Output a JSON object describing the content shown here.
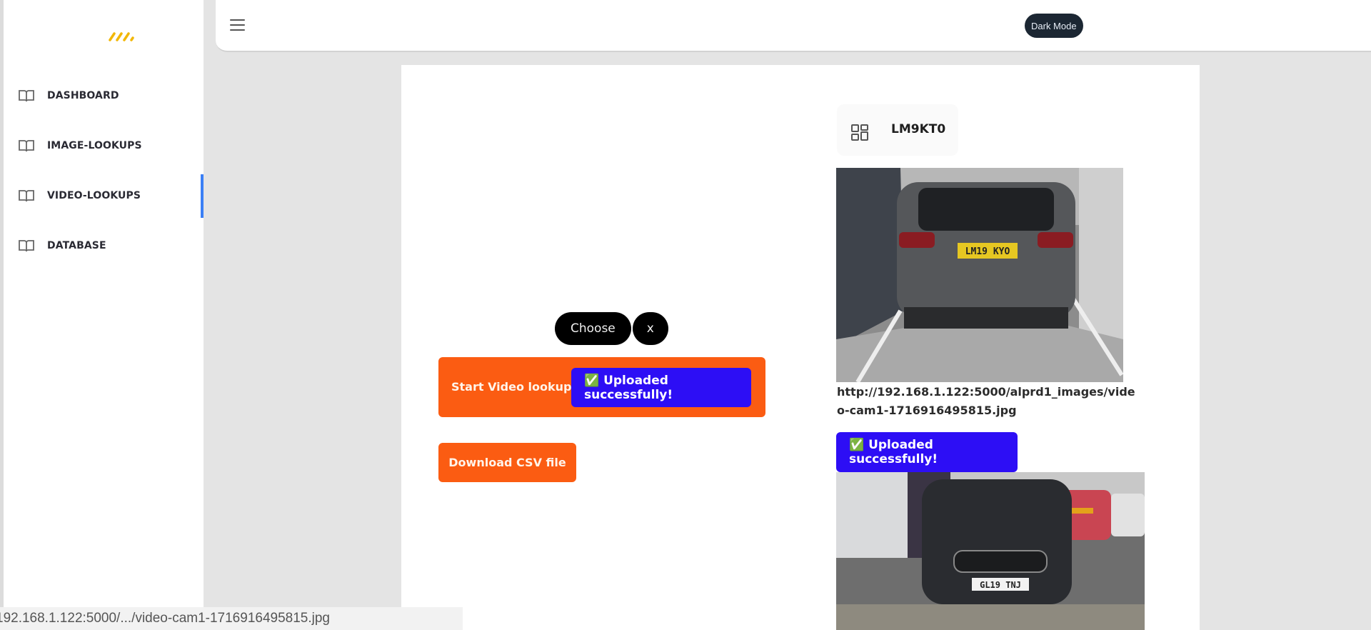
{
  "sidebar": {
    "logo": "logo-stripes",
    "items": [
      {
        "label": "DASHBOARD",
        "icon": "book-open-icon",
        "active": false
      },
      {
        "label": "IMAGE-LOOKUPS",
        "icon": "book-open-icon",
        "active": false
      },
      {
        "label": "VIDEO-LOOKUPS",
        "icon": "book-open-icon",
        "active": true
      },
      {
        "label": "DATABASE",
        "icon": "book-open-icon",
        "active": false
      }
    ],
    "active_color": "#3b7ff5"
  },
  "topbar": {
    "menu_icon": "hamburger-icon",
    "dark_mode_label": "Dark Mode"
  },
  "upload": {
    "choose_label": "Choose",
    "clear_label": "x",
    "start_label": "Start Video lookup",
    "status_label": "✅ Uploaded successfully!",
    "csv_label": "Download CSV file",
    "accent_color": "#fb5c12",
    "status_color": "#2d0ef5"
  },
  "results": {
    "plate_icon": "grid-icon",
    "plate_number": "LM9KT0",
    "image1_plate": "LM19 KYO",
    "image_url": "http://192.168.1.122:5000/alprd1_images/video-cam1-1716916495815.jpg",
    "status_label": "✅ Uploaded successfully!",
    "image2_plate": "GL19 TNJ"
  },
  "statusbar": {
    "link_preview": "192.168.1.122:5000/.../video-cam1-1716916495815.jpg"
  }
}
